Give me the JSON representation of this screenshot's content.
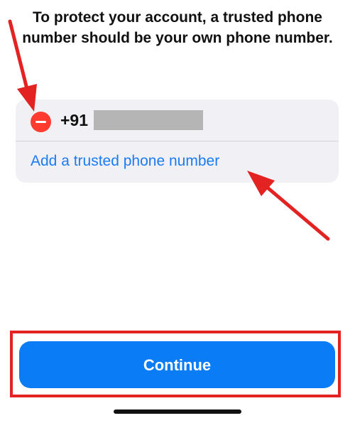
{
  "instruction": {
    "text": "To protect your account, a trusted phone number should be your own phone number."
  },
  "phone_card": {
    "country_code": "+91",
    "add_link_label": "Add a trusted phone number"
  },
  "continue_button": {
    "label": "Continue"
  },
  "colors": {
    "accent": "#1a7cf3",
    "primary_button": "#0a7cf5",
    "remove": "#ff3b30",
    "annotation": "#e32222",
    "card_background": "#f0f0f5"
  },
  "icons": {
    "remove": "minus-circle-icon",
    "annotation_arrow": "red-arrow-icon"
  }
}
